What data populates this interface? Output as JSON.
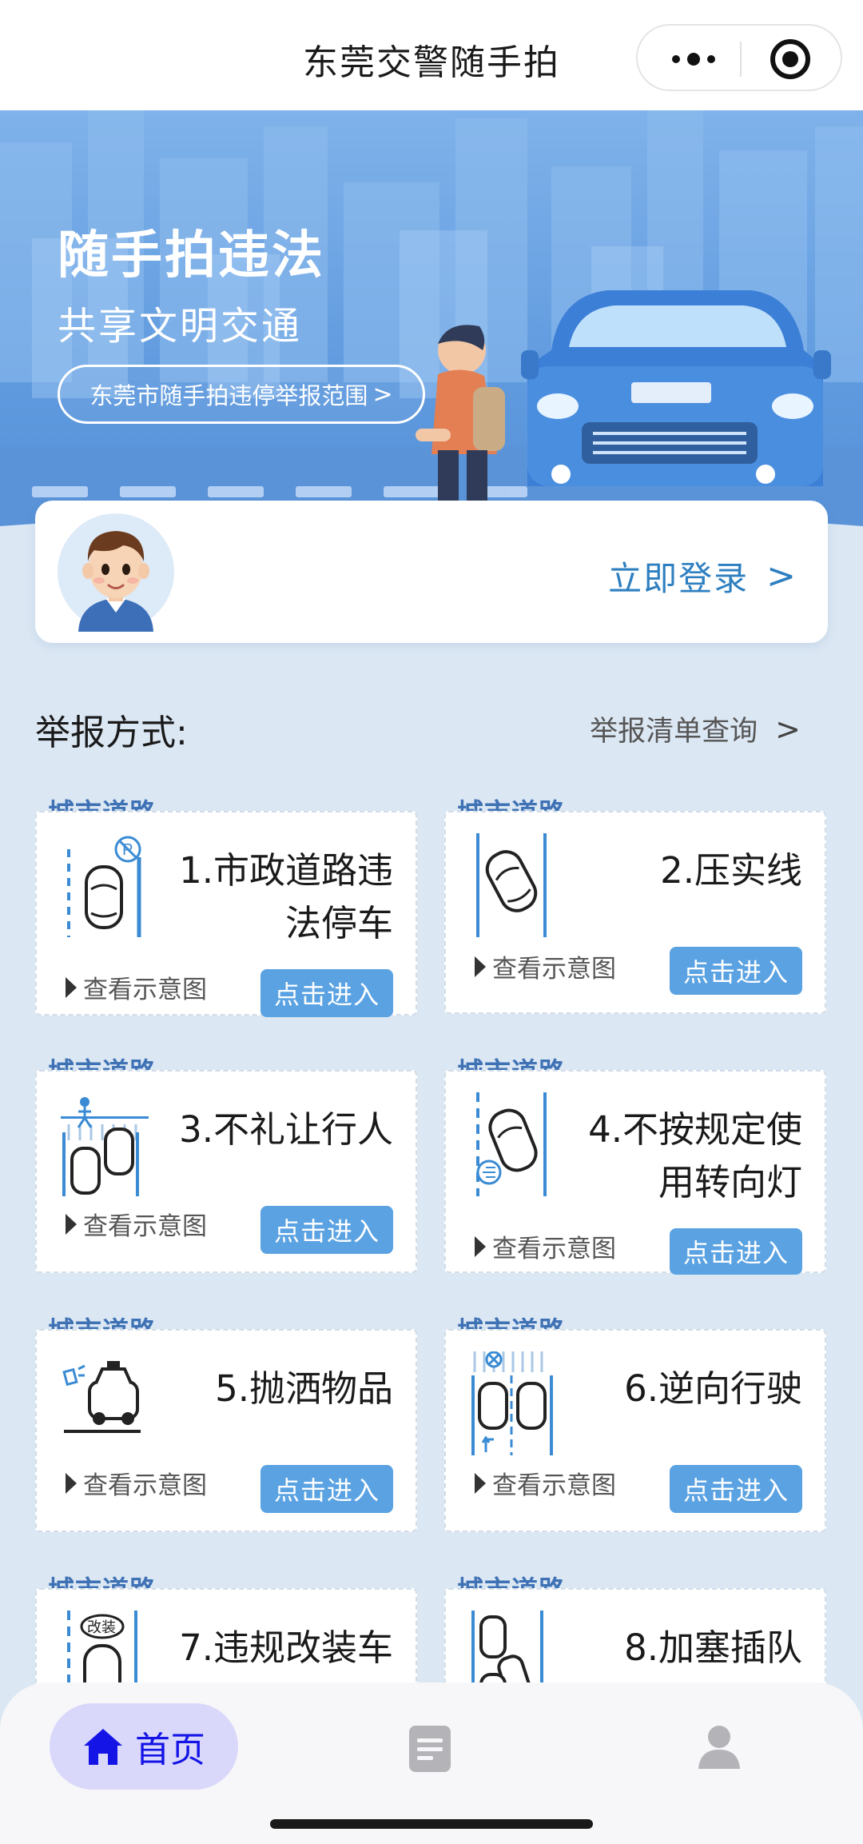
{
  "header": {
    "title": "东莞交警随手拍"
  },
  "banner": {
    "title": "随手拍违法",
    "subtitle": "共享文明交通",
    "scope_button": "东莞市随手拍违停举报范围",
    "scope_chevron": ">"
  },
  "login": {
    "label": "立即登录",
    "chevron": ">"
  },
  "section": {
    "title": "举报方式:",
    "list_link": "举报清单查询",
    "list_chevron": ">"
  },
  "cards": [
    {
      "tag": "城市道路",
      "title": "1.市政道路违法停车",
      "view": "查看示意图",
      "enter": "点击进入",
      "icon": "parking-icon"
    },
    {
      "tag": "城市道路",
      "title": "2.压实线",
      "view": "查看示意图",
      "enter": "点击进入",
      "icon": "solid-line-icon"
    },
    {
      "tag": "城市道路",
      "title": "3.不礼让行人",
      "view": "查看示意图",
      "enter": "点击进入",
      "icon": "pedestrian-icon"
    },
    {
      "tag": "城市道路",
      "title": "4.不按规定使用转向灯",
      "view": "查看示意图",
      "enter": "点击进入",
      "icon": "turn-signal-icon"
    },
    {
      "tag": "城市道路",
      "title": "5.抛洒物品",
      "view": "查看示意图",
      "enter": "点击进入",
      "icon": "littering-icon"
    },
    {
      "tag": "城市道路",
      "title": "6.逆向行驶",
      "view": "查看示意图",
      "enter": "点击进入",
      "icon": "wrong-way-icon"
    },
    {
      "tag": "城市道路",
      "title": "7.违规改装车",
      "icon": "modified-car-icon",
      "icon_text": "改装"
    },
    {
      "tag": "城市道路",
      "title": "8.加塞插队",
      "icon": "queue-jumping-icon"
    }
  ],
  "tabbar": {
    "home": "首页"
  },
  "colors": {
    "accent": "#5aa2e2",
    "tag": "#3f72b5",
    "link": "#2e7fc0",
    "tab_active": "#1414e6"
  }
}
